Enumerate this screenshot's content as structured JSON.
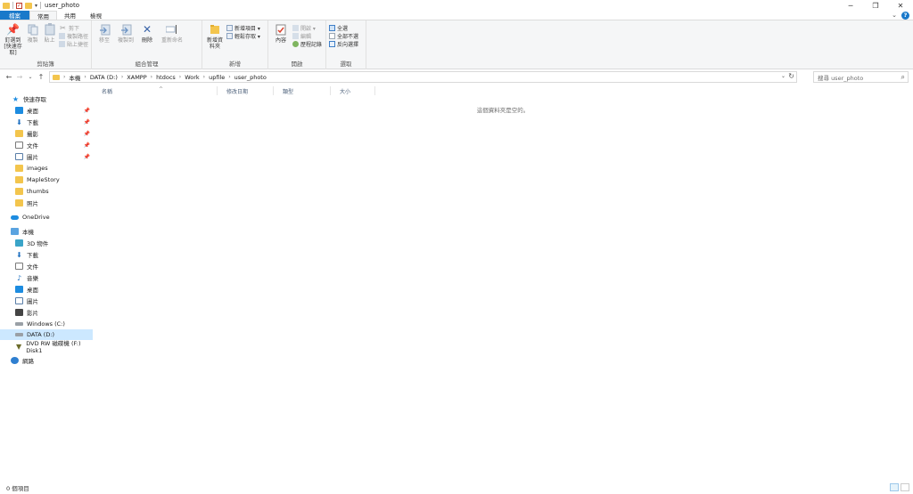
{
  "window": {
    "title": "user_photo"
  },
  "ribbon_tabs": [
    "檔案",
    "常用",
    "共用",
    "檢視"
  ],
  "ribbon": {
    "clipboard": {
      "label": "剪貼簿",
      "pin_label": "釘選到 [快速存取]",
      "copy_label": "複製",
      "paste_label": "貼上",
      "cut_label": "剪下",
      "copy_path_label": "複製路徑",
      "paste_shortcut_label": "貼上捷徑"
    },
    "organize": {
      "label": "組合管理",
      "move_to_label": "移至",
      "copy_to_label": "複製到",
      "delete_label": "刪除",
      "rename_label": "重新命名"
    },
    "new": {
      "label": "新增",
      "new_folder_label": "新增資料夾",
      "new_item_label": "新增項目 ▾",
      "easy_access_label": "輕鬆存取 ▾"
    },
    "open": {
      "label": "開啟",
      "properties_label": "內容",
      "open_label": "開啟 ▾",
      "edit_label": "編輯",
      "history_label": "歷程記錄"
    },
    "select": {
      "label": "選取",
      "select_all_label": "全選",
      "select_none_label": "全部不選",
      "invert_label": "反向選擇"
    }
  },
  "address": {
    "crumbs": [
      "本機",
      "DATA (D:)",
      "XAMPP",
      "htdocs",
      "Work",
      "upfile",
      "user_photo"
    ]
  },
  "search": {
    "placeholder": "搜尋 user_photo"
  },
  "nav": {
    "quick_access": "快速存取",
    "pinned": [
      "桌面",
      "下載",
      "攝影",
      "文件",
      "圖片"
    ],
    "recent": [
      "images",
      "MapleStory",
      "thumbs",
      "照片"
    ],
    "onedrive": "OneDrive",
    "this_pc": "本機",
    "pc_items": [
      "3D 物件",
      "下載",
      "文件",
      "音樂",
      "桌面",
      "圖片",
      "影片",
      "Windows (C:)",
      "DATA (D:)",
      "DVD RW 磁碟機 (F:) Disk1"
    ],
    "network": "網路"
  },
  "columns": [
    "名稱",
    "修改日期",
    "類型",
    "大小"
  ],
  "empty_message": "這個資料夾是空的。",
  "status": {
    "item_count": "0 個項目"
  }
}
